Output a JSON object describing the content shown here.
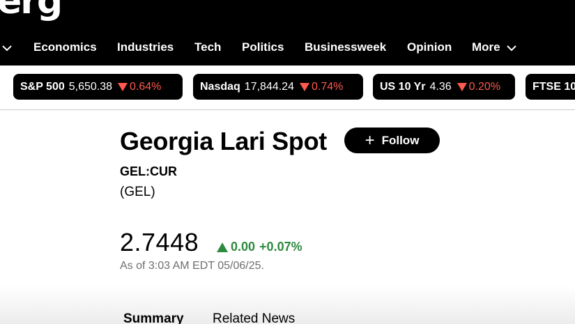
{
  "logo_text": "erg",
  "nav": {
    "items": [
      {
        "label": "Economics"
      },
      {
        "label": "Industries"
      },
      {
        "label": "Tech"
      },
      {
        "label": "Politics"
      },
      {
        "label": "Businessweek"
      },
      {
        "label": "Opinion"
      },
      {
        "label": "More"
      }
    ],
    "left_icon": "chevron-down-icon",
    "more_icon": "chevron-down-icon"
  },
  "tickers": [
    {
      "name": "S&P 500",
      "value": "5,650.38",
      "change": "0.64%",
      "direction": "down"
    },
    {
      "name": "Nasdaq",
      "value": "17,844.24",
      "change": "0.74%",
      "direction": "down"
    },
    {
      "name": "US 10 Yr",
      "value": "4.36",
      "change": "0.20%",
      "direction": "down"
    },
    {
      "name": "FTSE 10"
    }
  ],
  "quote": {
    "title": "Georgia Lari Spot",
    "follow_label": "Follow",
    "follow_icon": "plus-icon",
    "ticker": "GEL:CUR",
    "currency": "(GEL)",
    "price": "2.7448",
    "change_abs": "0.00",
    "change_pct": "+0.07%",
    "direction": "up",
    "as_of": "As of 3:03 AM EDT 05/06/25."
  },
  "tabs": [
    {
      "label": "Summary"
    },
    {
      "label": "Related News"
    }
  ],
  "colors": {
    "down": "#ff5a4f",
    "up": "#2d8a3e",
    "header_bg": "#000000"
  }
}
